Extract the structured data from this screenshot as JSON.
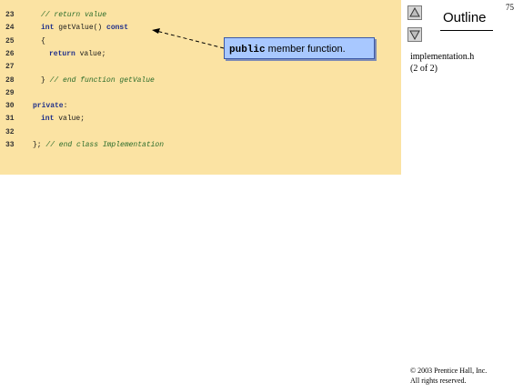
{
  "page_number": "75",
  "outline": {
    "title": "Outline",
    "up_icon": "triangle-up-icon",
    "down_icon": "triangle-down-icon"
  },
  "file": {
    "name": "implementation.h",
    "part": "(2 of 2)"
  },
  "callout": {
    "keyword": "public",
    "text": " member function."
  },
  "code": [
    {
      "n": "23",
      "text": "// return value",
      "kind": "comment",
      "indent": 2
    },
    {
      "n": "24",
      "text": "int getValue() const",
      "kind": "code",
      "indent": 2
    },
    {
      "n": "25",
      "text": "{",
      "kind": "code",
      "indent": 2
    },
    {
      "n": "26",
      "text": "return value;",
      "kind": "code",
      "indent": 3
    },
    {
      "n": "27",
      "text": "",
      "kind": "code",
      "indent": 0
    },
    {
      "n": "28",
      "text": "} // end function getValue",
      "kind": "code",
      "indent": 2
    },
    {
      "n": "29",
      "text": "",
      "kind": "code",
      "indent": 0
    },
    {
      "n": "30",
      "text": "private:",
      "kind": "code",
      "indent": 1
    },
    {
      "n": "31",
      "text": "int value;",
      "kind": "code",
      "indent": 2
    },
    {
      "n": "32",
      "text": "",
      "kind": "code",
      "indent": 0
    },
    {
      "n": "33",
      "text": "}; // end class Implementation",
      "kind": "code",
      "indent": 1
    }
  ],
  "copyright": {
    "line1": "© 2003 Prentice Hall, Inc.",
    "line2": "All rights reserved."
  },
  "colors": {
    "code_background": "#fbe3a3",
    "callout_background": "#a8c8ff"
  }
}
